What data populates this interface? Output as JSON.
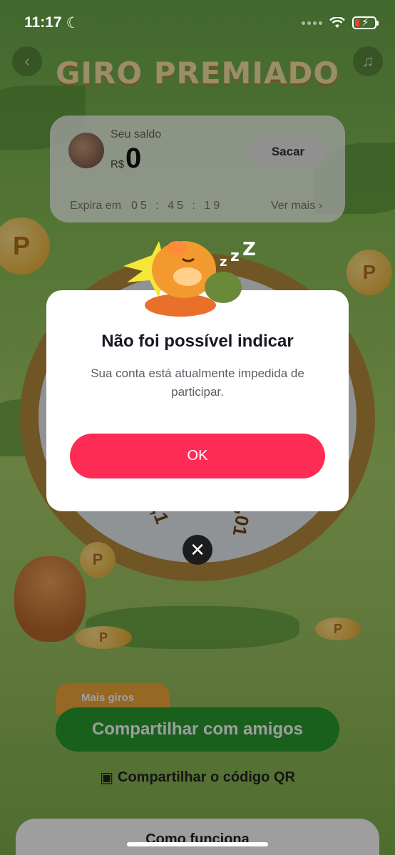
{
  "status_bar": {
    "time": "11:17"
  },
  "game": {
    "title": "GIRO PREMIADO",
    "balance": {
      "label": "Seu saldo",
      "currency": "R$",
      "amount": "0",
      "withdraw_label": "Sacar",
      "expires_label": "Expira em",
      "timer": "05 : 45 : 19",
      "see_more_label": "Ver mais"
    },
    "wheel_labels": [
      "0,1",
      "0,01"
    ],
    "coin_letter": "P",
    "more_spins_label": "Mais giros",
    "share_label": "Compartilhar com amigos",
    "qr_label": "Compartilhar o código QR",
    "how_it_works_label": "Como funciona"
  },
  "modal": {
    "title": "Não foi possível indicar",
    "message": "Sua conta está atualmente impedida de participar.",
    "ok_label": "OK"
  },
  "colors": {
    "accent": "#fe2c55",
    "share_green": "#2a9b30",
    "title_gold": "#f7e6a6"
  }
}
